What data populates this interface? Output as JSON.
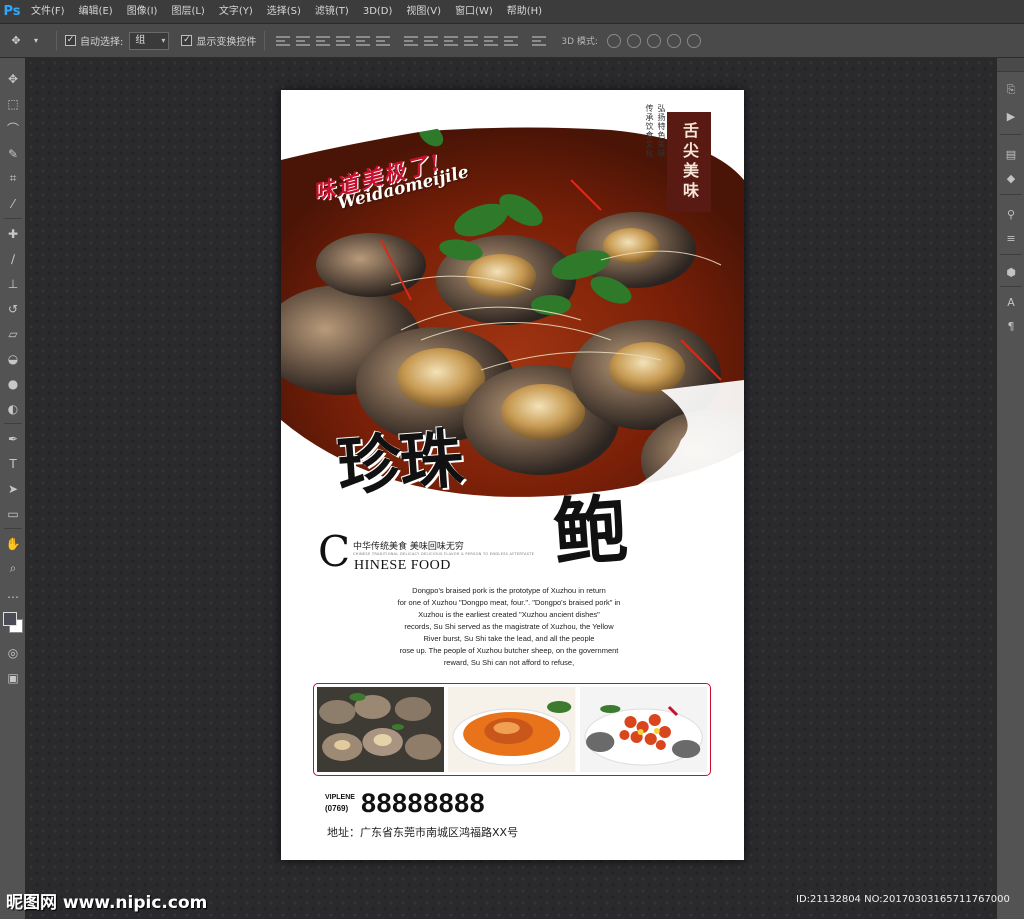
{
  "app": {
    "logo": "Ps"
  },
  "menubar": {
    "items": [
      {
        "label": "文件(F)"
      },
      {
        "label": "编辑(E)"
      },
      {
        "label": "图像(I)"
      },
      {
        "label": "图层(L)"
      },
      {
        "label": "文字(Y)"
      },
      {
        "label": "选择(S)"
      },
      {
        "label": "滤镜(T)"
      },
      {
        "label": "3D(D)"
      },
      {
        "label": "视图(V)"
      },
      {
        "label": "窗口(W)"
      },
      {
        "label": "帮助(H)"
      }
    ]
  },
  "options_bar": {
    "auto_select_label": "自动选择:",
    "auto_select_checked": true,
    "auto_select_value": "组",
    "show_transform_label": "显示变换控件",
    "show_transform_checked": true,
    "mode3d_label": "3D 模式:"
  },
  "colors": {
    "foreground": "#4b4b55",
    "background": "#ffffff",
    "accent_red": "#c8102e",
    "seal_brown": "#5a1a14"
  },
  "poster": {
    "slogan_cn": "味道美极了!",
    "slogan_pinyin": "Weidaomeijile",
    "vertical_left": "传承饮食文化",
    "vertical_right": "弘扬特色美味",
    "seal_text": "舌尖美味",
    "title_main": "珍珠",
    "title_last": "鲍",
    "tagline_cn": "中华传统美食  美味回味无穷",
    "tagline_en_small": "CHINESE TRADITIONAL DELICACY DELICIOUS FLAVOR & PERSON TO ENDLESS AFTERTASTE",
    "big_c": "C",
    "chinese_food": "HINESE FOOD",
    "body_lines": [
      "Dongpo's braised pork is the prototype of Xuzhou in return",
      "for one of Xuzhou \"Dongpo meat, four.\". \"Dongpo's braised pork\" in",
      "Xuzhou is the earliest created \"Xuzhou ancient dishes\"",
      "records, Su Shi served as the magistrate of Xuzhou, the Yellow",
      "River burst, Su Shi take the lead, and all the people",
      "rose up. The people of Xuzhou butcher sheep, on the government",
      "reward, Su Shi can not afford to refuse,"
    ],
    "brand_tag": "VIPLENE",
    "area_code": "(0769)",
    "phone": "88888888",
    "address": "地址：广东省东莞市南城区鸿福路XX号"
  },
  "watermarks": {
    "left": "昵图网 www.nipic.com",
    "right": "ID:21132804 NO:20170303165711767000"
  }
}
